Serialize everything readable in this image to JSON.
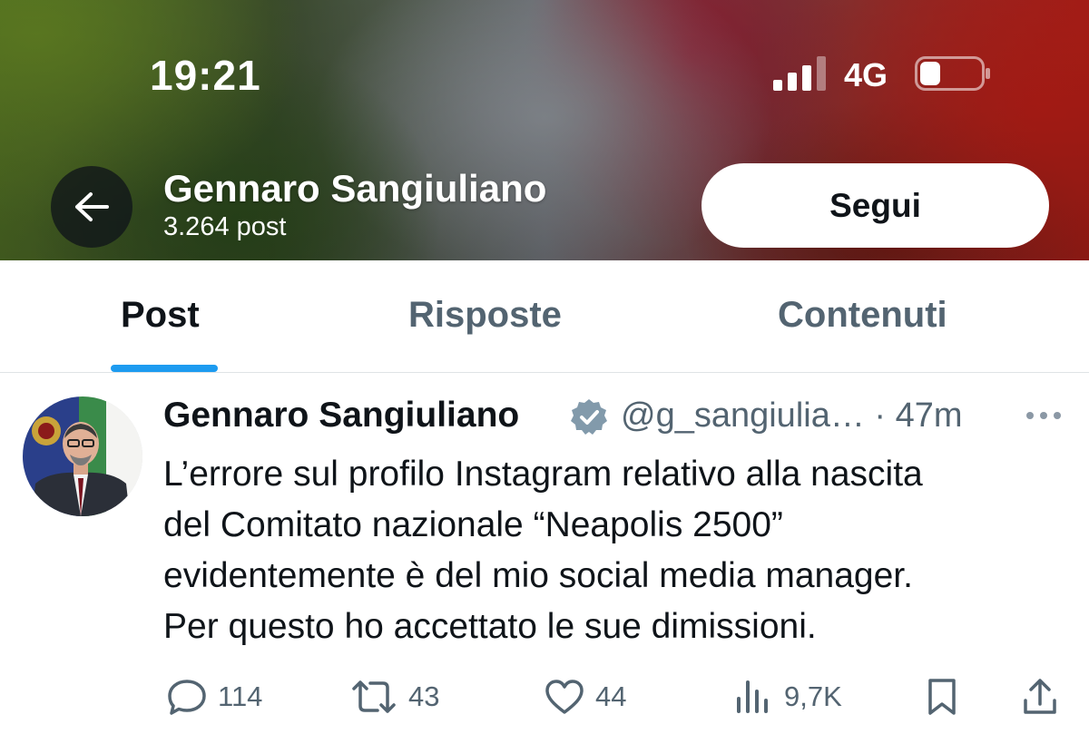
{
  "status_bar": {
    "time": "19:21",
    "network": "4G"
  },
  "header": {
    "name": "Gennaro Sangiuliano",
    "post_count": "3.264 post",
    "follow_label": "Segui"
  },
  "tabs": [
    {
      "label": "Post",
      "active": true
    },
    {
      "label": "Risposte",
      "active": false
    },
    {
      "label": "Contenuti",
      "active": false
    }
  ],
  "post": {
    "author": "Gennaro Sangiuliano",
    "handle": "@g_sangiulia…",
    "time": "· 47m",
    "lines": [
      "L’errore sul profilo Instagram relativo alla nascita",
      "del Comitato nazionale “Neapolis 2500”",
      "evidentemente è del mio social media manager.",
      "Per questo ho accettato le sue dimissioni."
    ],
    "actions": {
      "replies": "114",
      "reposts": "43",
      "likes": "44",
      "views": "9,7K"
    }
  },
  "colors": {
    "accent": "#1d9bf0",
    "text": "#0f1419",
    "muted": "#536471"
  },
  "icons": [
    "back-arrow-icon",
    "signal-icon",
    "battery-icon",
    "verified-badge-icon",
    "more-icon",
    "reply-icon",
    "repost-icon",
    "like-icon",
    "views-icon",
    "bookmark-icon",
    "share-icon"
  ]
}
